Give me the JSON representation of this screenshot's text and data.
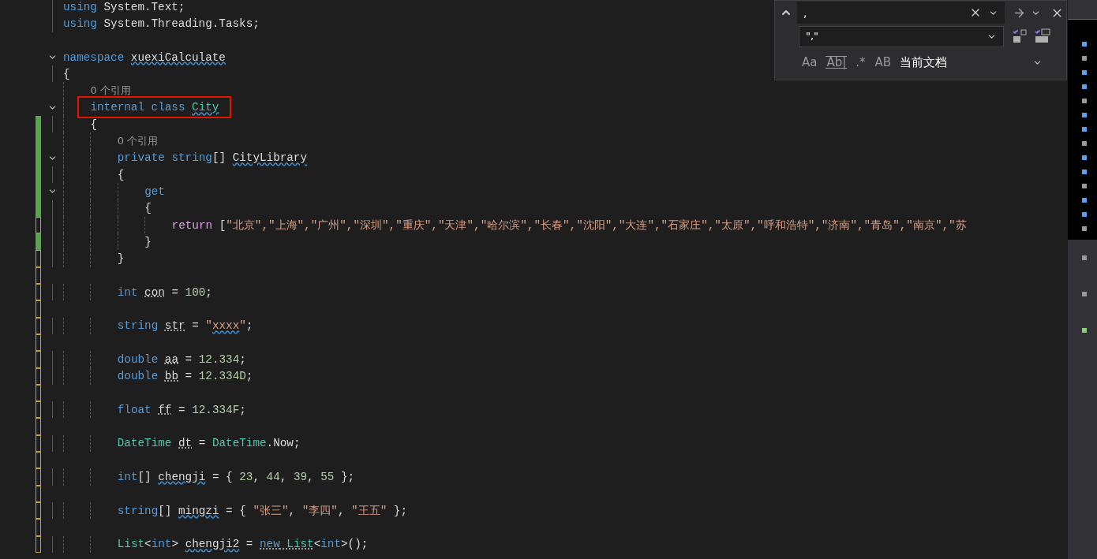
{
  "editor": {
    "lines": [
      {
        "kind": "code",
        "fold": false,
        "boxed": false,
        "tokens": [
          {
            "t": "using ",
            "kind": "keyword"
          },
          {
            "t": "System.Text;",
            "kind": "plain"
          }
        ]
      },
      {
        "kind": "code",
        "fold": false,
        "boxed": false,
        "tokens": [
          {
            "t": "using ",
            "kind": "keyword"
          },
          {
            "t": "System.Threading.Tasks;",
            "kind": "plain"
          }
        ]
      },
      {
        "kind": "blank"
      },
      {
        "kind": "code",
        "fold": true,
        "boxed": false,
        "tokens": [
          {
            "t": "namespace ",
            "kind": "keyword"
          },
          {
            "t": "xuexiCalculate",
            "kind": "plain",
            "wavy": true
          }
        ]
      },
      {
        "kind": "code",
        "fold": false,
        "boxed": false,
        "tokens": [
          {
            "t": "{",
            "kind": "plain"
          }
        ]
      },
      {
        "kind": "codelens",
        "tokens": [
          {
            "t": "    0 个引用",
            "kind": "lens"
          }
        ]
      },
      {
        "kind": "code",
        "fold": true,
        "boxed": true,
        "tokens": [
          {
            "t": "    internal class ",
            "kind": "keyword"
          },
          {
            "t": "City",
            "kind": "type",
            "wavy": true
          }
        ]
      },
      {
        "kind": "code",
        "color": "#57a64a",
        "fold": false,
        "boxed": false,
        "tokens": [
          {
            "t": "    {",
            "kind": "plain"
          }
        ]
      },
      {
        "kind": "codelens",
        "color": "#57a64a",
        "tokens": [
          {
            "t": "        0 个引用",
            "kind": "lens"
          }
        ]
      },
      {
        "kind": "code",
        "color": "#57a64a",
        "fold": true,
        "boxed": false,
        "tokens": [
          {
            "t": "        private string",
            "kind": "keyword"
          },
          {
            "t": "[] ",
            "kind": "plain"
          },
          {
            "t": "CityLibrary",
            "kind": "plain",
            "wavy": true
          }
        ]
      },
      {
        "kind": "code",
        "color": "#57a64a",
        "fold": false,
        "boxed": false,
        "tokens": [
          {
            "t": "        {",
            "kind": "plain"
          }
        ]
      },
      {
        "kind": "code",
        "color": "#57a64a",
        "fold": true,
        "boxed": false,
        "tokens": [
          {
            "t": "            get",
            "kind": "keyword"
          }
        ]
      },
      {
        "kind": "code",
        "color": "#57a64a",
        "fold": false,
        "boxed": false,
        "tokens": [
          {
            "t": "            {",
            "kind": "plain"
          }
        ]
      },
      {
        "kind": "code",
        "color": "#c8a223",
        "fold": false,
        "boxed": false,
        "tokens": [
          {
            "t": "                return",
            "kind": "control"
          },
          {
            "t": " [",
            "kind": "plain"
          },
          {
            "t": "\"北京\",\"上海\",\"广州\",\"深圳\",\"重庆\",\"天津\",\"哈尔滨\",\"长春\",\"沈阳\",\"大连\",\"石家庄\",\"太原\",\"呼和浩特\",\"济南\",\"青岛\",\"南京\",\"苏",
            "kind": "string"
          }
        ]
      },
      {
        "kind": "code",
        "color": "#57a64a",
        "fold": false,
        "boxed": false,
        "tokens": [
          {
            "t": "            }",
            "kind": "plain"
          }
        ]
      },
      {
        "kind": "code",
        "color": "#c8a223",
        "fold": false,
        "boxed": false,
        "tokens": [
          {
            "t": "        }",
            "kind": "plain"
          }
        ]
      },
      {
        "kind": "blank",
        "color": "#c8a223"
      },
      {
        "kind": "code",
        "color": "#c8a223",
        "fold": false,
        "boxed": false,
        "tokens": [
          {
            "t": "        int ",
            "kind": "keyword"
          },
          {
            "t": "con",
            "kind": "plain",
            "dotted": true
          },
          {
            "t": " = ",
            "kind": "plain"
          },
          {
            "t": "100",
            "kind": "number"
          },
          {
            "t": ";",
            "kind": "plain"
          }
        ]
      },
      {
        "kind": "blank",
        "color": "#c8a223"
      },
      {
        "kind": "code",
        "color": "#c8a223",
        "fold": false,
        "boxed": false,
        "tokens": [
          {
            "t": "        string ",
            "kind": "keyword"
          },
          {
            "t": "str",
            "kind": "plain",
            "dotted": true
          },
          {
            "t": " = ",
            "kind": "plain"
          },
          {
            "t": "\"",
            "kind": "string"
          },
          {
            "t": "xxxx",
            "kind": "string",
            "wavy": true
          },
          {
            "t": "\"",
            "kind": "string"
          },
          {
            "t": ";",
            "kind": "plain"
          }
        ]
      },
      {
        "kind": "blank",
        "color": "#c8a223"
      },
      {
        "kind": "code",
        "color": "#c8a223",
        "fold": false,
        "boxed": false,
        "tokens": [
          {
            "t": "        double ",
            "kind": "keyword"
          },
          {
            "t": "aa",
            "kind": "plain",
            "dotted": true
          },
          {
            "t": " = ",
            "kind": "plain"
          },
          {
            "t": "12.334",
            "kind": "number"
          },
          {
            "t": ";",
            "kind": "plain"
          }
        ]
      },
      {
        "kind": "code",
        "color": "#c8a223",
        "fold": false,
        "boxed": false,
        "tokens": [
          {
            "t": "        double ",
            "kind": "keyword"
          },
          {
            "t": "bb",
            "kind": "plain",
            "dotted": true
          },
          {
            "t": " = ",
            "kind": "plain"
          },
          {
            "t": "12.334D",
            "kind": "number"
          },
          {
            "t": ";",
            "kind": "plain"
          }
        ]
      },
      {
        "kind": "blank",
        "color": "#c8a223"
      },
      {
        "kind": "code",
        "color": "#c8a223",
        "fold": false,
        "boxed": false,
        "tokens": [
          {
            "t": "        float ",
            "kind": "keyword"
          },
          {
            "t": "ff",
            "kind": "plain",
            "dotted": true
          },
          {
            "t": " = ",
            "kind": "plain"
          },
          {
            "t": "12.334F",
            "kind": "number"
          },
          {
            "t": ";",
            "kind": "plain"
          }
        ]
      },
      {
        "kind": "blank",
        "color": "#c8a223"
      },
      {
        "kind": "code",
        "color": "#c8a223",
        "fold": false,
        "boxed": false,
        "tokens": [
          {
            "t": "        DateTime ",
            "kind": "type"
          },
          {
            "t": "dt",
            "kind": "plain",
            "dotted": true
          },
          {
            "t": " = ",
            "kind": "plain"
          },
          {
            "t": "DateTime",
            "kind": "type"
          },
          {
            "t": ".Now;",
            "kind": "plain"
          }
        ]
      },
      {
        "kind": "blank",
        "color": "#c8a223"
      },
      {
        "kind": "code",
        "color": "#c8a223",
        "fold": false,
        "boxed": false,
        "tokens": [
          {
            "t": "        int",
            "kind": "keyword"
          },
          {
            "t": "[] ",
            "kind": "plain"
          },
          {
            "t": "chengji",
            "kind": "plain",
            "wavy": true
          },
          {
            "t": " = { ",
            "kind": "plain"
          },
          {
            "t": "23",
            "kind": "number"
          },
          {
            "t": ", ",
            "kind": "plain"
          },
          {
            "t": "44",
            "kind": "number"
          },
          {
            "t": ", ",
            "kind": "plain"
          },
          {
            "t": "39",
            "kind": "number"
          },
          {
            "t": ", ",
            "kind": "plain"
          },
          {
            "t": "55",
            "kind": "number"
          },
          {
            "t": " };",
            "kind": "plain"
          }
        ]
      },
      {
        "kind": "blank",
        "color": "#c8a223"
      },
      {
        "kind": "code",
        "color": "#c8a223",
        "fold": false,
        "boxed": false,
        "tokens": [
          {
            "t": "        string",
            "kind": "keyword"
          },
          {
            "t": "[] ",
            "kind": "plain"
          },
          {
            "t": "mingzi",
            "kind": "plain",
            "wavy": true
          },
          {
            "t": " = { ",
            "kind": "plain"
          },
          {
            "t": "\"张三\"",
            "kind": "string"
          },
          {
            "t": ", ",
            "kind": "plain"
          },
          {
            "t": "\"李四\"",
            "kind": "string"
          },
          {
            "t": ", ",
            "kind": "plain"
          },
          {
            "t": "\"王五\"",
            "kind": "string"
          },
          {
            "t": " };",
            "kind": "plain"
          }
        ]
      },
      {
        "kind": "blank",
        "color": "#c8a223"
      },
      {
        "kind": "code",
        "color": "#c8a223",
        "fold": false,
        "boxed": false,
        "tokens": [
          {
            "t": "        List",
            "kind": "type"
          },
          {
            "t": "<",
            "kind": "plain"
          },
          {
            "t": "int",
            "kind": "keyword"
          },
          {
            "t": "> ",
            "kind": "plain"
          },
          {
            "t": "chengji2",
            "kind": "plain",
            "wavy": true
          },
          {
            "t": " = ",
            "kind": "plain"
          },
          {
            "t": "new",
            "kind": "keyword",
            "dotted": true
          },
          {
            "t": " List",
            "kind": "type",
            "dotted": true
          },
          {
            "t": "<",
            "kind": "plain"
          },
          {
            "t": "int",
            "kind": "keyword"
          },
          {
            "t": ">();",
            "kind": "plain"
          }
        ]
      }
    ]
  },
  "find_panel": {
    "expanded": true,
    "find_value": ",",
    "replace_value": "\",\"",
    "scope": "当前文档",
    "options": [
      {
        "kind": "match-case",
        "label": "Aa",
        "selected": false
      },
      {
        "kind": "whole-word",
        "label": "Ab|",
        "selected": false
      },
      {
        "kind": "regex",
        "label": ".*",
        "selected": false
      },
      {
        "kind": "preserve-case",
        "label": "AB",
        "selected": false
      }
    ]
  }
}
